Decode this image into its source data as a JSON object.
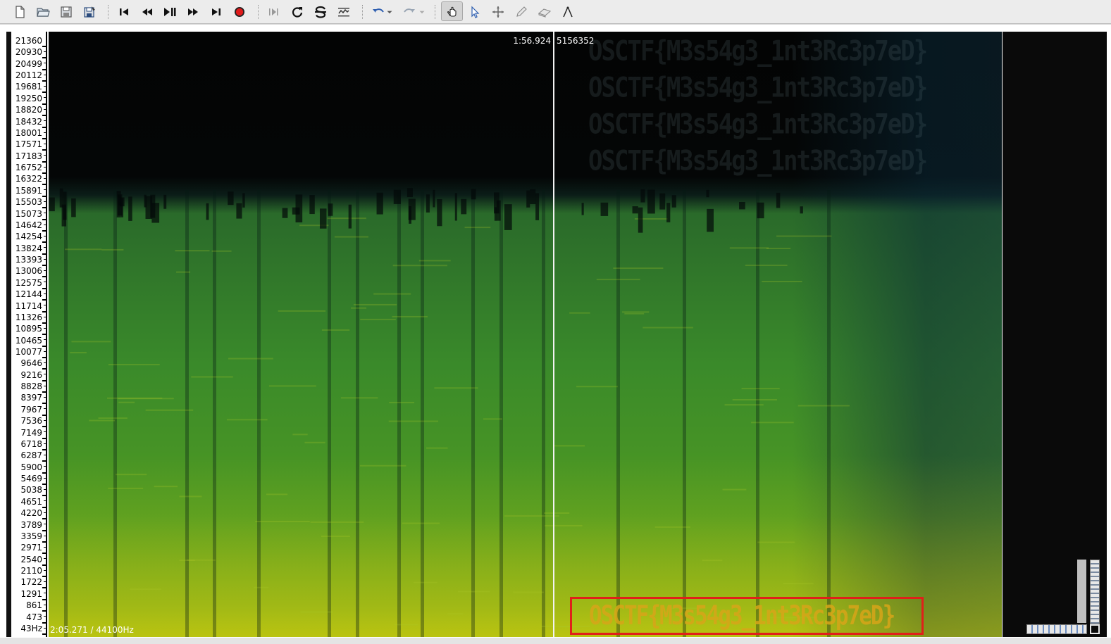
{
  "toolbar": {
    "items": [
      {
        "icon": "new-file-icon"
      },
      {
        "icon": "open-folder-icon"
      },
      {
        "icon": "save-icon"
      },
      {
        "icon": "save-as-icon"
      },
      {
        "icon": "skip-to-start-icon"
      },
      {
        "icon": "rewind-icon"
      },
      {
        "icon": "play-pause-icon"
      },
      {
        "icon": "fast-forward-icon"
      },
      {
        "icon": "skip-to-end-icon"
      },
      {
        "icon": "record-icon"
      },
      {
        "icon": "play-selection-icon"
      },
      {
        "icon": "loop-icon"
      },
      {
        "icon": "solo-icon"
      },
      {
        "icon": "scroll-icon"
      },
      {
        "icon": "undo-icon"
      },
      {
        "icon": "redo-icon"
      },
      {
        "icon": "navigate-hand-icon"
      },
      {
        "icon": "select-arrow-icon"
      },
      {
        "icon": "move-icon"
      },
      {
        "icon": "draw-pencil-icon"
      },
      {
        "icon": "erase-icon"
      },
      {
        "icon": "measure-icon"
      }
    ],
    "active_tool": "navigate-hand-icon",
    "record_color": "#e01b1b"
  },
  "spectrogram": {
    "cursor_time": "1:56.924",
    "cursor_sample": "5156352",
    "duration_rate": "2:05.271 / 44100Hz",
    "hidden_text_top": "OSCTF{M3s54g3_1nt3Rc3p7eD}",
    "hidden_text_flag": "OSCTF{M3s54g3_1nt3Rc3p7eD}",
    "highlight_color": "#e0201a",
    "frequency_labels": [
      "21360",
      "20930",
      "20499",
      "20112",
      "19681",
      "19250",
      "18820",
      "18432",
      "18001",
      "17571",
      "17183",
      "16752",
      "16322",
      "15891",
      "15503",
      "15073",
      "14642",
      "14254",
      "13824",
      "13393",
      "13006",
      "12575",
      "12144",
      "11714",
      "11326",
      "10895",
      "10465",
      "10077",
      "9646",
      "9216",
      "8828",
      "8397",
      "7967",
      "7536",
      "7149",
      "6718",
      "6287",
      "5900",
      "5469",
      "5038",
      "4651",
      "4220",
      "3789",
      "3359",
      "2971",
      "2540",
      "2110",
      "1722",
      "1291",
      "861",
      "473",
      "43Hz"
    ]
  }
}
